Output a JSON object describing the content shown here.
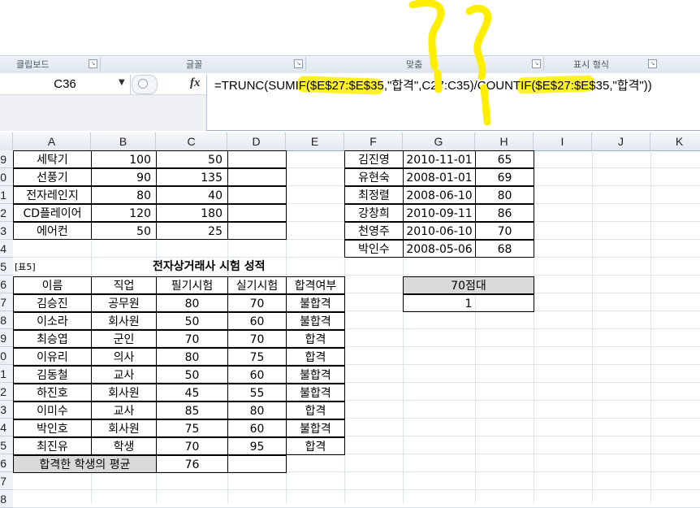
{
  "ribbon": {
    "groups": [
      {
        "label": "클립보드"
      },
      {
        "label": "글꼴"
      },
      {
        "label": "맞춤"
      },
      {
        "label": "표시 형식"
      }
    ]
  },
  "formula_bar": {
    "name_box": "C36",
    "fx": "fx",
    "formula": "=TRUNC(SUMIF($E$27:$E$35,\"합격\",C27:C35)/COUNTIF($E$27:$E$35,\"합격\"))"
  },
  "columns": [
    "A",
    "B",
    "C",
    "D",
    "E",
    "F",
    "G",
    "H",
    "I",
    "J",
    "K"
  ],
  "rows": [
    "9",
    "0",
    "1",
    "2",
    "3",
    "4",
    "5",
    "6",
    "7",
    "8",
    "9",
    "0",
    "1",
    "2",
    "3",
    "4",
    "5",
    "6",
    "7",
    "8"
  ],
  "top_table": [
    {
      "item": "세탁기",
      "b": "100",
      "c": "50"
    },
    {
      "item": "선풍기",
      "b": "90",
      "c": "135"
    },
    {
      "item": "전자레인지",
      "b": "80",
      "c": "40"
    },
    {
      "item": "CD플레이어",
      "b": "120",
      "c": "180"
    },
    {
      "item": "에어컨",
      "b": "50",
      "c": "25"
    }
  ],
  "right_table": [
    {
      "name": "김진영",
      "date": "2010-11-01",
      "score": "65"
    },
    {
      "name": "유현숙",
      "date": "2008-01-01",
      "score": "69"
    },
    {
      "name": "최정렬",
      "date": "2008-06-10",
      "score": "80"
    },
    {
      "name": "강창희",
      "date": "2010-09-11",
      "score": "86"
    },
    {
      "name": "천영주",
      "date": "2010-06-10",
      "score": "70"
    },
    {
      "name": "박인수",
      "date": "2008-05-06",
      "score": "68"
    }
  ],
  "exam": {
    "tag": "[표5]",
    "title": "전자상거래사 시험 성적",
    "headers": [
      "이름",
      "직업",
      "필기시험",
      "실기시험",
      "합격여부"
    ],
    "rows": [
      {
        "name": "김승진",
        "job": "공무원",
        "written": "80",
        "practical": "70",
        "result": "불합격"
      },
      {
        "name": "이소라",
        "job": "회사원",
        "written": "50",
        "practical": "60",
        "result": "불합격"
      },
      {
        "name": "최승엽",
        "job": "군인",
        "written": "70",
        "practical": "70",
        "result": "합격"
      },
      {
        "name": "이유리",
        "job": "의사",
        "written": "80",
        "practical": "75",
        "result": "합격"
      },
      {
        "name": "김동철",
        "job": "교사",
        "written": "50",
        "practical": "60",
        "result": "불합격"
      },
      {
        "name": "하진호",
        "job": "회사원",
        "written": "45",
        "practical": "55",
        "result": "불합격"
      },
      {
        "name": "이미수",
        "job": "교사",
        "written": "85",
        "practical": "80",
        "result": "합격"
      },
      {
        "name": "박인호",
        "job": "회사원",
        "written": "75",
        "practical": "60",
        "result": "불합격"
      },
      {
        "name": "최진유",
        "job": "학생",
        "written": "70",
        "practical": "95",
        "result": "합격"
      }
    ],
    "avg_label": "합격한 학생의 평균",
    "avg_value": "76"
  },
  "side_box": {
    "header": "70점대",
    "value": "1"
  },
  "colors": {
    "annotation": "#ffee00",
    "header_fill": "#d9d9d9"
  }
}
